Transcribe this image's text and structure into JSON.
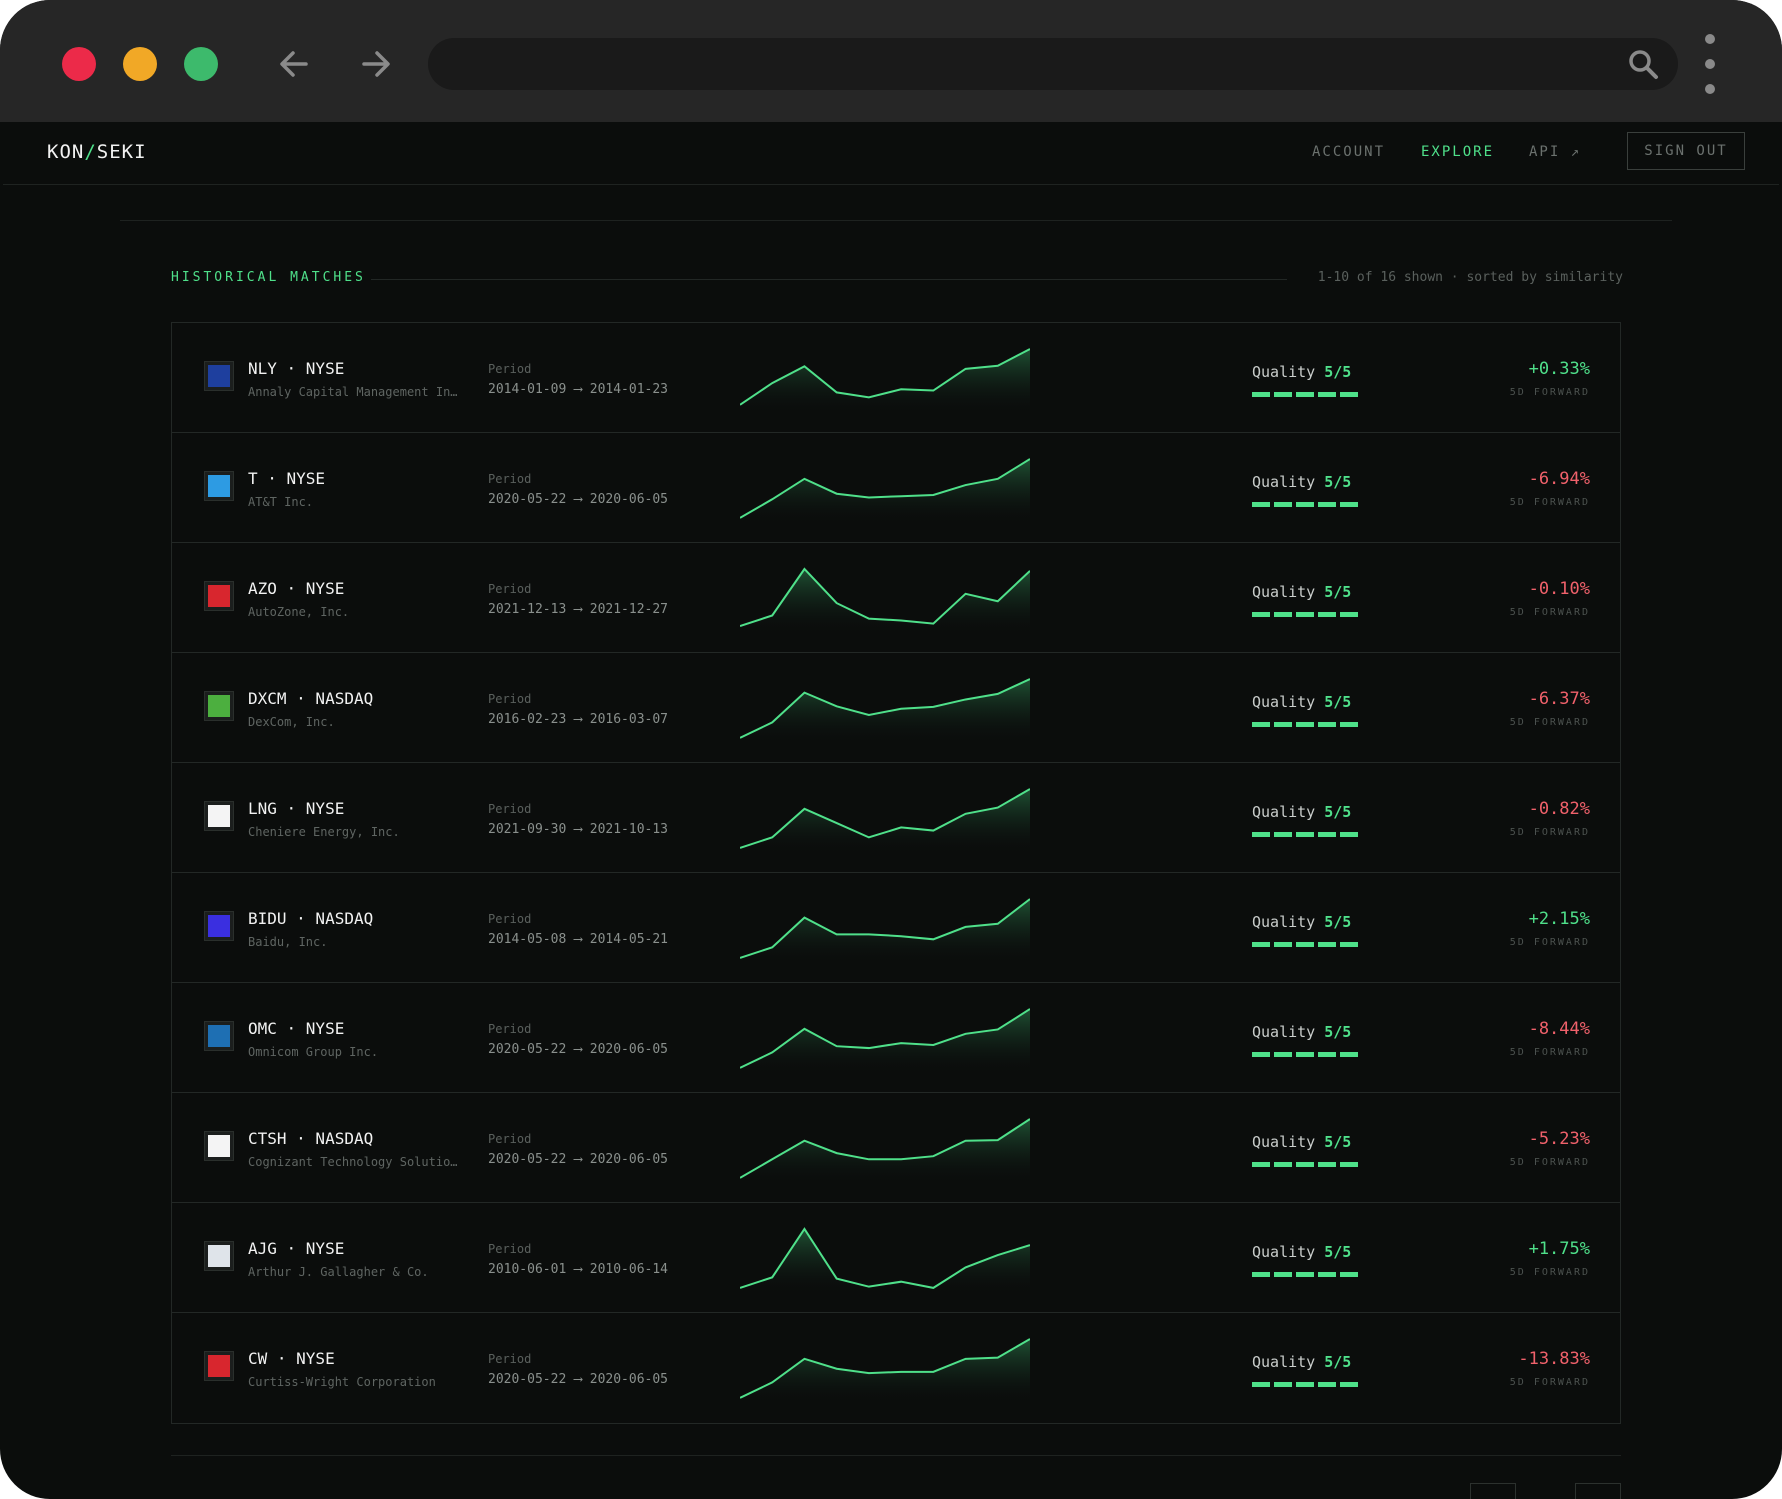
{
  "browser": {
    "back_icon": "arrow-left-icon",
    "forward_icon": "arrow-right-icon",
    "search_icon": "search-icon",
    "menu_icon": "kebab-menu-icon"
  },
  "header": {
    "logo_left": "KON",
    "logo_sep": "/",
    "logo_right": "SEKI",
    "nav": {
      "account": "ACCOUNT",
      "explore": "EXPLORE",
      "api": "API ↗"
    },
    "signout": "SIGN OUT"
  },
  "section": {
    "title": "HISTORICAL MATCHES",
    "meta": "1-10 of 16 shown · sorted by similarity"
  },
  "colors": {
    "accent": "#4fe08a",
    "negative": "#f0616b",
    "background": "#0b0d0c"
  },
  "matches": [
    {
      "ticker": "NLY · NYSE",
      "company": "Annaly Capital Management In…",
      "period_label": "Period",
      "period": "2014-01-09 ⟶ 2014-01-23",
      "quality_label": "Quality",
      "quality": "5/5",
      "quality_level": 5,
      "return": "+0.33%",
      "return_label": "5D FORWARD",
      "logo_color": "#1e3f9e",
      "spark": [
        0.1,
        0.45,
        0.72,
        0.3,
        0.22,
        0.35,
        0.33,
        0.68,
        0.73,
        1.0
      ]
    },
    {
      "ticker": "T · NYSE",
      "company": "AT&T Inc.",
      "period_label": "Period",
      "period": "2020-05-22 ⟶ 2020-06-05",
      "quality_label": "Quality",
      "quality": "5/5",
      "quality_level": 5,
      "return": "-6.94%",
      "return_label": "5D FORWARD",
      "logo_color": "#2d9be3",
      "spark": [
        0.05,
        0.35,
        0.68,
        0.44,
        0.38,
        0.4,
        0.42,
        0.58,
        0.68,
        1.0
      ]
    },
    {
      "ticker": "AZO · NYSE",
      "company": "AutoZone, Inc.",
      "period_label": "Period",
      "period": "2021-12-13 ⟶ 2021-12-27",
      "quality_label": "Quality",
      "quality": "5/5",
      "quality_level": 5,
      "return": "-0.10%",
      "return_label": "5D FORWARD",
      "logo_color": "#d8262e",
      "spark": [
        0.08,
        0.25,
        1.0,
        0.45,
        0.2,
        0.17,
        0.12,
        0.6,
        0.48,
        0.97
      ]
    },
    {
      "ticker": "DXCM · NASDAQ",
      "company": "DexCom, Inc.",
      "period_label": "Period",
      "period": "2016-02-23 ⟶ 2016-03-07",
      "quality_label": "Quality",
      "quality": "5/5",
      "quality_level": 5,
      "return": "-6.37%",
      "return_label": "5D FORWARD",
      "logo_color": "#4caf3f",
      "spark": [
        0.05,
        0.3,
        0.78,
        0.56,
        0.42,
        0.52,
        0.55,
        0.67,
        0.76,
        1.0
      ]
    },
    {
      "ticker": "LNG · NYSE",
      "company": "Cheniere Energy, Inc.",
      "period_label": "Period",
      "period": "2021-09-30 ⟶ 2021-10-13",
      "quality_label": "Quality",
      "quality": "5/5",
      "quality_level": 5,
      "return": "-0.82%",
      "return_label": "5D FORWARD",
      "logo_color": "#f4f4f4",
      "spark": [
        0.05,
        0.22,
        0.68,
        0.45,
        0.22,
        0.38,
        0.33,
        0.6,
        0.7,
        1.0
      ]
    },
    {
      "ticker": "BIDU · NASDAQ",
      "company": "Baidu, Inc.",
      "period_label": "Period",
      "period": "2014-05-08 ⟶ 2014-05-21",
      "quality_label": "Quality",
      "quality": "5/5",
      "quality_level": 5,
      "return": "+2.15%",
      "return_label": "5D FORWARD",
      "logo_color": "#3a2fe0",
      "spark": [
        0.05,
        0.22,
        0.7,
        0.43,
        0.43,
        0.4,
        0.35,
        0.55,
        0.6,
        1.0
      ]
    },
    {
      "ticker": "OMC · NYSE",
      "company": "Omnicom Group Inc.",
      "period_label": "Period",
      "period": "2020-05-22 ⟶ 2020-06-05",
      "quality_label": "Quality",
      "quality": "5/5",
      "quality_level": 5,
      "return": "-8.44%",
      "return_label": "5D FORWARD",
      "logo_color": "#1e6fb3",
      "spark": [
        0.05,
        0.3,
        0.68,
        0.4,
        0.37,
        0.45,
        0.42,
        0.6,
        0.67,
        1.0
      ]
    },
    {
      "ticker": "CTSH · NASDAQ",
      "company": "Cognizant Technology Solutio…",
      "period_label": "Period",
      "period": "2020-05-22 ⟶ 2020-06-05",
      "quality_label": "Quality",
      "quality": "5/5",
      "quality_level": 5,
      "return": "-5.23%",
      "return_label": "5D FORWARD",
      "logo_color": "#f4f4f4",
      "spark": [
        0.05,
        0.35,
        0.65,
        0.45,
        0.35,
        0.35,
        0.4,
        0.65,
        0.66,
        1.0
      ]
    },
    {
      "ticker": "AJG · NYSE",
      "company": "Arthur J. Gallagher & Co.",
      "period_label": "Period",
      "period": "2010-06-01 ⟶ 2010-06-14",
      "quality_label": "Quality",
      "quality": "5/5",
      "quality_level": 5,
      "return": "+1.75%",
      "return_label": "5D FORWARD",
      "logo_color": "#dfe4ea",
      "spark": [
        0.05,
        0.22,
        1.0,
        0.2,
        0.07,
        0.15,
        0.05,
        0.38,
        0.58,
        0.74
      ]
    },
    {
      "ticker": "CW · NYSE",
      "company": "Curtiss-Wright Corporation",
      "period_label": "Period",
      "period": "2020-05-22 ⟶ 2020-06-05",
      "quality_label": "Quality",
      "quality": "5/5",
      "quality_level": 5,
      "return": "-13.83%",
      "return_label": "5D FORWARD",
      "logo_color": "#d8262e",
      "spark": [
        0.05,
        0.3,
        0.68,
        0.52,
        0.45,
        0.47,
        0.47,
        0.68,
        0.7,
        1.0
      ]
    }
  ]
}
